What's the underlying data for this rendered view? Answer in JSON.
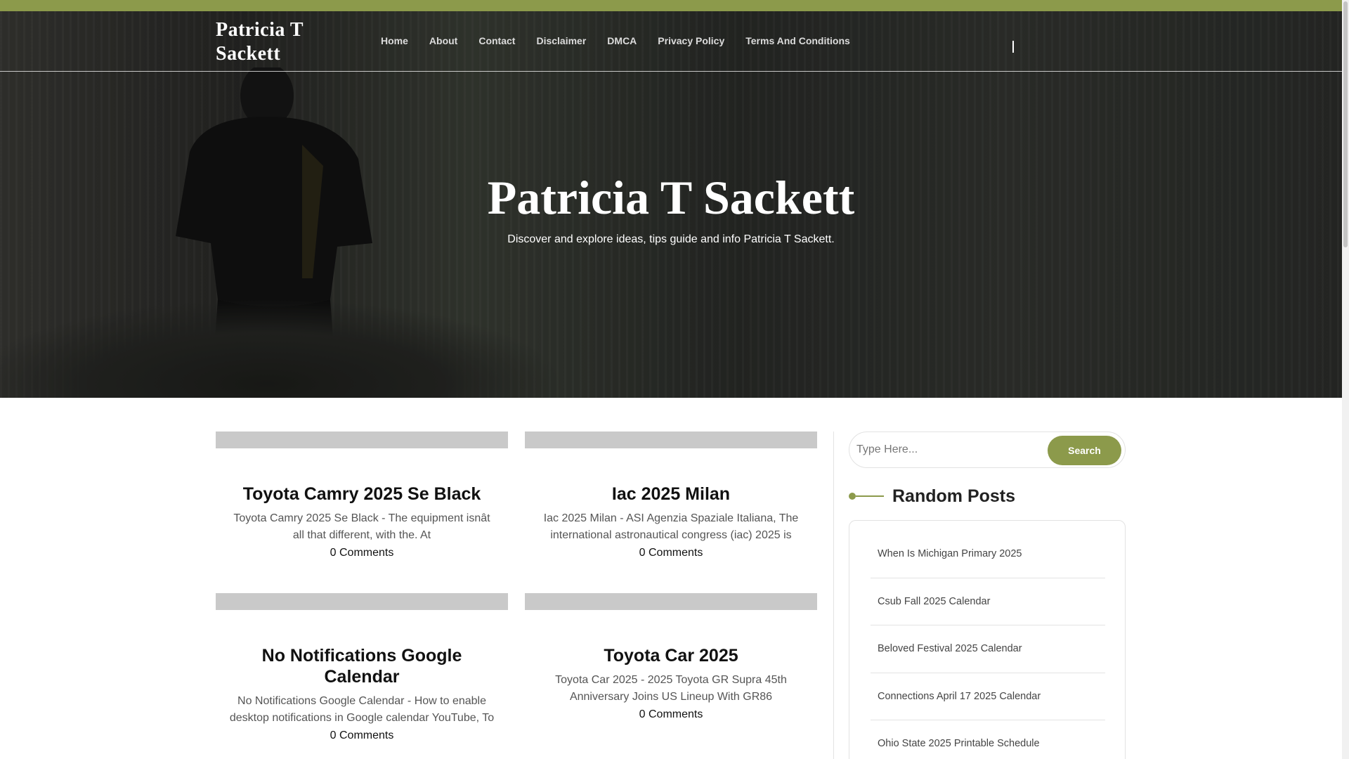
{
  "site": {
    "brand": "Patricia T Sackett",
    "menu": [
      "Home",
      "About",
      "Contact",
      "Disclaimer",
      "DMCA",
      "Privacy Policy",
      "Terms And Conditions"
    ]
  },
  "hero": {
    "title": "Patricia T Sackett",
    "subtitle": "Discover and explore ideas, tips guide and info Patricia T Sackett."
  },
  "posts": [
    {
      "title": "Toyota Camry 2025 Se Black",
      "excerpt": "Toyota Camry 2025 Se Black - The equipment isnât all that different, with the. At",
      "comments": "0 Comments"
    },
    {
      "title": "Iac 2025 Milan",
      "excerpt": "Iac 2025 Milan - ASI Agenzia Spaziale Italiana, The international astronautical congress (iac) 2025 is",
      "comments": "0 Comments"
    },
    {
      "title": "No Notifications Google Calendar",
      "excerpt": "No Notifications Google Calendar - How to enable desktop notifications in Google calendar YouTube, To",
      "comments": "0 Comments"
    },
    {
      "title": "Toyota Car 2025",
      "excerpt": "Toyota Car 2025 - 2025 Toyota GR Supra 45th Anniversary Joins US Lineup With GR86",
      "comments": "0 Comments"
    }
  ],
  "sidebar": {
    "search_placeholder": "Type Here...",
    "search_button": "Search",
    "widget_title": "Random Posts",
    "random_posts": [
      "When Is Michigan Primary 2025",
      "Csub Fall 2025 Calendar",
      "Beloved Festival 2025 Calendar",
      "Connections April 17 2025 Calendar",
      "Ohio State 2025 Printable Schedule"
    ]
  },
  "colors": {
    "accent": "#8c9a4b"
  }
}
